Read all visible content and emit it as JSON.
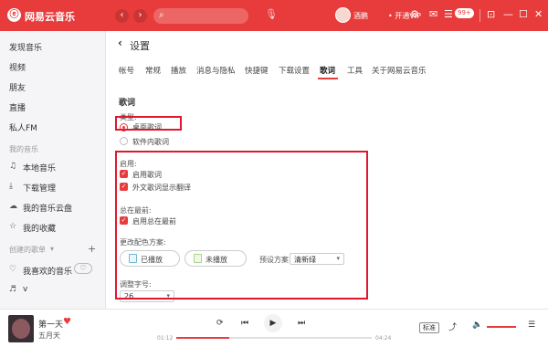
{
  "app": {
    "name": "网易云音乐",
    "logo_glyph": "ⓔ"
  },
  "titlebar": {
    "back_icon": "‹",
    "forward_icon": "›",
    "search_placeholder": "",
    "search_icon_glyph": "⌕",
    "mic_icon_glyph": "🎙",
    "username": "酒鹏",
    "vip": "• 开通VIP",
    "settings_icon_glyph": "⚙",
    "mail_icon_glyph": "✉",
    "skin_icon_glyph": "☰",
    "badge": "99+",
    "mini_icon_glyph": "⊡",
    "min_icon_glyph": "—",
    "max_icon_glyph": "☐",
    "close_icon_glyph": "✕"
  },
  "sidebar": {
    "items_top": [
      "发现音乐",
      "视频",
      "朋友",
      "直播",
      "私人FM"
    ],
    "my_music_title": "我的音乐",
    "my_music_items": [
      {
        "icon": "♫",
        "label": "本地音乐"
      },
      {
        "icon": "⤓",
        "label": "下载管理"
      },
      {
        "icon": "☁",
        "label": "我的音乐云盘"
      },
      {
        "icon": "☆",
        "label": "我的收藏"
      }
    ],
    "created_title": "创建的歌单",
    "created_arrow": "▾",
    "add_icon_glyph": "+",
    "playlists": [
      {
        "icon": "♡",
        "label": "我喜欢的音乐"
      },
      {
        "icon": "♬",
        "label": "v"
      }
    ],
    "heartbeat_glyph": "♡"
  },
  "main": {
    "back_glyph": "‹",
    "title": "设置",
    "tabs": [
      "帐号",
      "常规",
      "播放",
      "消息与隐私",
      "快捷键",
      "下载设置",
      "歌词",
      "工具",
      "关于网易云音乐"
    ],
    "active_tab": "歌词",
    "section_title": "歌词",
    "type_label": "类型:",
    "type_options": [
      "桌面歌词",
      "软件内歌词"
    ],
    "enable_label": "启用:",
    "enable_options": [
      "启用歌词",
      "外文歌词显示翻译"
    ],
    "ontop_label": "总在最前:",
    "ontop_options": [
      "启用总在最前"
    ],
    "color_label": "更改配色方案:",
    "played_label": "已播放",
    "unplayed_label": "未播放",
    "preset_label": "预设方案",
    "preset_value": "清新绿",
    "fontsize_label": "调整字号:",
    "fontsize_value": "26",
    "dropdown_glyph": "▾",
    "check_glyph": "✓",
    "colors": {
      "played": "#6bbad6",
      "unplayed": "#a6d58a",
      "accent": "#e83c3c",
      "highlight": "#e0182d"
    }
  },
  "player": {
    "song": "第一天",
    "artist": "五月天",
    "heart_glyph": "♥",
    "elapsed": "01:12",
    "total": "04:24",
    "progress": 0.27,
    "quality": "标准",
    "prev_glyph": "⏮",
    "play_glyph": "▶",
    "next_glyph": "⏭",
    "loop_glyph": "⟳",
    "share_glyph": "⤴",
    "volume_glyph": "🔈",
    "list_glyph": "☰"
  }
}
